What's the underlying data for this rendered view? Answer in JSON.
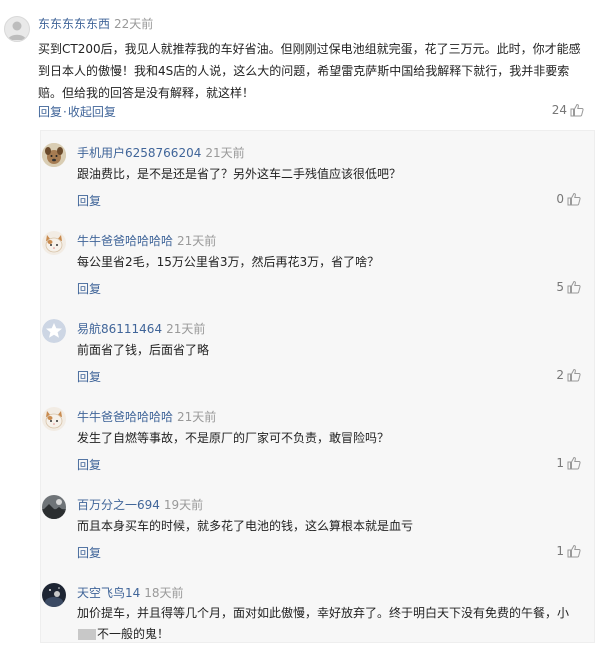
{
  "colors": {
    "link": "#406599",
    "time": "#999999",
    "text": "#222222",
    "reply_bg": "#f7f7f7"
  },
  "main_comment": {
    "username": "东东东东东西",
    "time": "22天前",
    "text": "买到CT200后，我见人就推荐我的车好省油。但刚刚过保电池组就完蛋，花了三万元。此时，你才能感到日本人的傲慢！我和4S店的人说，这么大的问题，希望雷克萨斯中国给我解释下就行，我并非要索赔。但给我的回答是没有解释，就这样！",
    "reply_label": "回复",
    "separator": "·",
    "collapse_label": "收起回复",
    "likes": "24",
    "avatar_icon": "default-avatar-icon"
  },
  "replies": [
    {
      "username": "手机用户6258766204",
      "time": "21天前",
      "text": "跟油费比，是不是还是省了？另外这车二手残值应该很低吧？",
      "reply_label": "回复",
      "likes": "0",
      "avatar_icon": "dog-avatar-icon"
    },
    {
      "username": "牛牛爸爸哈哈哈哈",
      "time": "21天前",
      "text": "每公里省2毛，15万公里省3万，然后再花3万，省了啥？",
      "reply_label": "回复",
      "likes": "5",
      "avatar_icon": "cat-avatar-icon"
    },
    {
      "username": "易航86111464",
      "time": "21天前",
      "text": "前面省了钱，后面省了略",
      "reply_label": "回复",
      "likes": "2",
      "avatar_icon": "star-avatar-icon"
    },
    {
      "username": "牛牛爸爸哈哈哈哈",
      "time": "21天前",
      "text": "发生了自燃等事故，不是原厂的厂家可不负责，敢冒险吗？",
      "reply_label": "回复",
      "likes": "1",
      "avatar_icon": "cat-avatar-icon"
    },
    {
      "username": "百万分之一694",
      "time": "19天前",
      "text": "而且本身买车的时候，就多花了电池的钱，这么算根本就是血亏",
      "reply_label": "回复",
      "likes": "1",
      "avatar_icon": "landscape-avatar-icon"
    },
    {
      "username": "天空飞鸟14",
      "time": "18天前",
      "text_part1": "加价提车，并且得等几个月，面对如此傲慢，幸好放弃了。终于明白天下没有免费的午餐，小",
      "text_part2": "不一般的鬼！",
      "avatar_icon": "night-avatar-icon"
    }
  ]
}
